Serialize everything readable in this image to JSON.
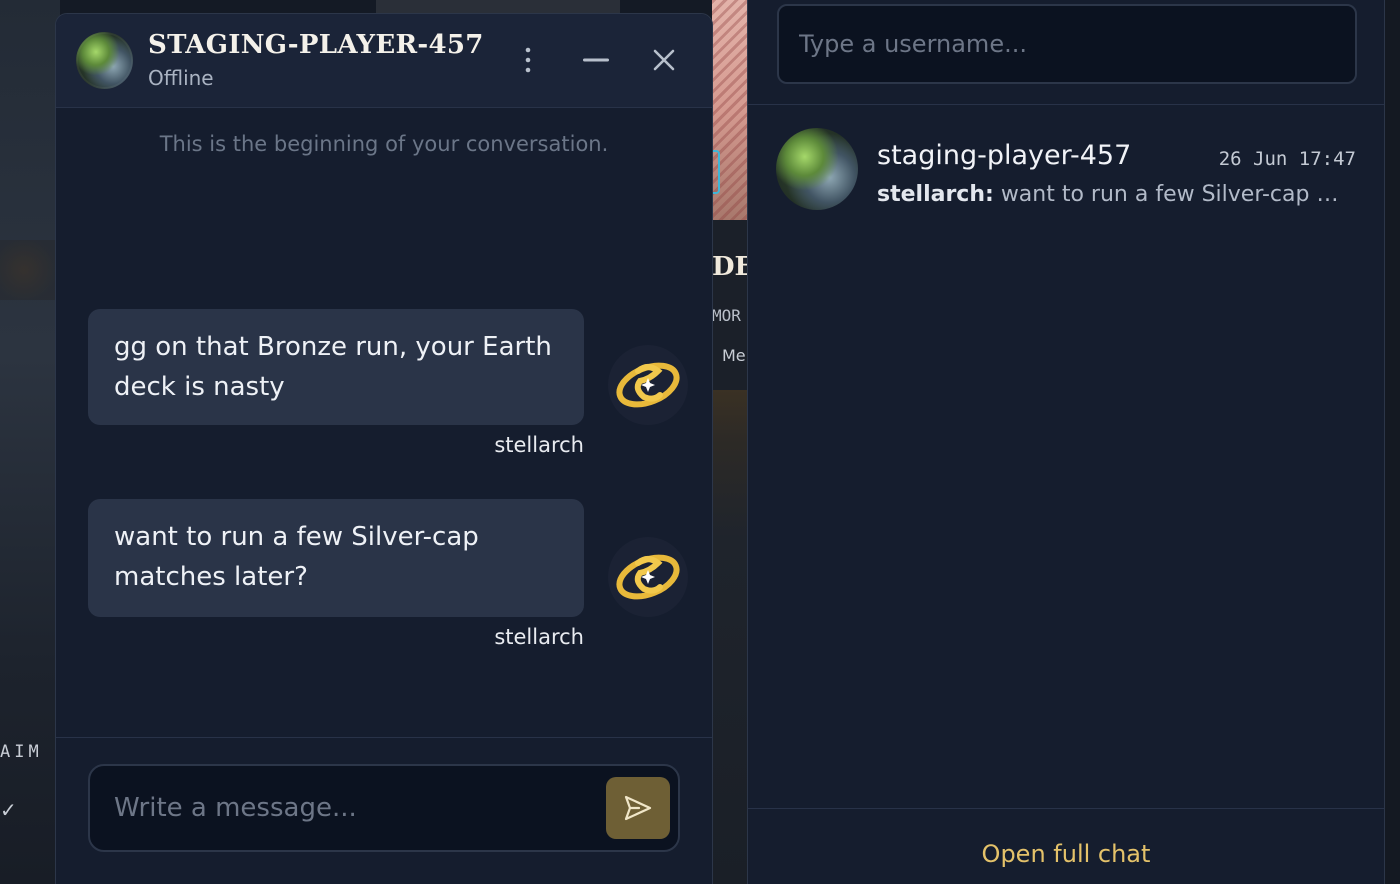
{
  "background": {
    "left_text": "AIM",
    "left_check": "✓",
    "mid_title": "DE-",
    "mid_more": "MOR",
    "mid_me": "Me"
  },
  "chat": {
    "title": "STAGING-PLAYER-457",
    "status": "Offline",
    "beginning_note": "This is the beginning of your conversation.",
    "messages": [
      {
        "text": "gg on that Bronze run, your Earth deck is nasty",
        "author": "stellarch"
      },
      {
        "text": "want to run a few Silver-cap matches later?",
        "author": "stellarch"
      }
    ],
    "composer": {
      "placeholder": "Write a message..."
    },
    "icons": {
      "menu": "more-vertical-icon",
      "minimize": "minimize-icon",
      "close": "close-icon",
      "send": "send-icon"
    }
  },
  "sidebar": {
    "search": {
      "placeholder": "Type a username..."
    },
    "conversations": [
      {
        "name": "staging-player-457",
        "time": "26 Jun 17:47",
        "preview_author": "stellarch:",
        "preview_text": "want to run a few Silver-cap mat..."
      }
    ],
    "open_full_label": "Open full chat"
  },
  "colors": {
    "accent": "#e4c26a",
    "send_button": "#6e5f35",
    "panel_bg": "#151d2e",
    "bubble_bg": "#2a3448"
  }
}
